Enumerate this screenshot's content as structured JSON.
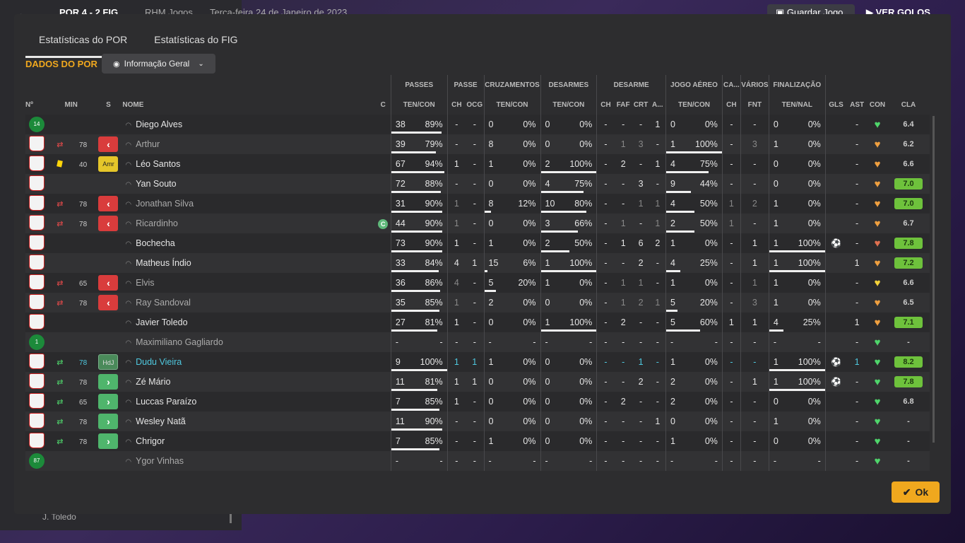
{
  "topbar": {
    "back_icon": "arrow-left-icon",
    "score": "POR   4 - 2   FIG",
    "stadium": "RHM Jogos",
    "date": "Terça-feira 24 de Janeiro de 2023",
    "save_label": "Guardar Jogo",
    "goals_label": "VER GOLOS"
  },
  "bottom": {
    "name": "J. Toledo"
  },
  "tabs": [
    "Estatísticas do POR",
    "Estatísticas do FIG"
  ],
  "section_title": "DADOS DO POR",
  "dropdown": {
    "label": "Informação Geral"
  },
  "ok_label": "Ok",
  "groups": {
    "passes": "PASSES",
    "passe": "PASSE",
    "cruz": "CRUZAMENTOS",
    "desarmes": "DESARMES",
    "desarme": "DESARME",
    "aereo": "JOGO AÉREO",
    "ca": "CA...",
    "varios": "VÁRIOS",
    "final": "FINALIZAÇÃO"
  },
  "headers": {
    "no": "Nº",
    "min": "MIN",
    "s": "S",
    "nome": "NOME",
    "c": "C",
    "tencon": "TEN/CON",
    "ch": "CH",
    "ocg": "OCG",
    "faf": "FAF",
    "crt": "CRT",
    "a": "A...",
    "fnt": "FNT",
    "tennal": "TEN/NAL",
    "gls": "GLS",
    "ast": "AST",
    "con": "CON",
    "cla": "CLA"
  },
  "colors": {
    "accent": "#f0a81e",
    "sub_out": "#d93c3c",
    "sub_in": "#4fb56c",
    "rating_green": "#6ec23c",
    "highlight": "#4fc9e0"
  },
  "players": [
    {
      "num": "14",
      "gk": true,
      "sub": "",
      "min": "",
      "s": "",
      "name": "Diego Alves",
      "style": "",
      "cap": false,
      "passes": [
        "38",
        "89%",
        0.89
      ],
      "p_ch": "-",
      "p_ocg": "-",
      "cr": [
        "0",
        "0%",
        0
      ],
      "des": [
        "0",
        "0%",
        0
      ],
      "d_ch": "-",
      "d_faf": "-",
      "d_crt": "-",
      "d_a": "1",
      "aer": [
        "0",
        "0%",
        0
      ],
      "ca": "-",
      "fnt": "-",
      "fin": [
        "0",
        "0%",
        0
      ],
      "gls": "",
      "ast": "-",
      "con": "green",
      "cla": "6.4",
      "cla_g": false
    },
    {
      "num": "",
      "gk": false,
      "sub": "out",
      "min": "78",
      "s": "out",
      "name": "Arthur",
      "style": "dim",
      "cap": false,
      "passes": [
        "39",
        "79%",
        0.79
      ],
      "p_ch": "-",
      "p_ocg": "-",
      "cr": [
        "8",
        "0%",
        0
      ],
      "des": [
        "0",
        "0%",
        0
      ],
      "d_ch": "-",
      "d_faf": "1",
      "d_crt": "3",
      "d_a": "-",
      "aer": [
        "1",
        "100%",
        1
      ],
      "ca": "-",
      "fnt": "3",
      "fin": [
        "1",
        "0%",
        0
      ],
      "gls": "",
      "ast": "-",
      "con": "orange",
      "cla": "6.2",
      "cla_g": false
    },
    {
      "num": "",
      "gk": false,
      "sub": "yellow",
      "min": "40",
      "s": "amr",
      "name": "Léo Santos",
      "style": "",
      "cap": false,
      "passes": [
        "67",
        "94%",
        0.94
      ],
      "p_ch": "1",
      "p_ocg": "-",
      "cr": [
        "1",
        "0%",
        0
      ],
      "des": [
        "2",
        "100%",
        1
      ],
      "d_ch": "-",
      "d_faf": "2",
      "d_crt": "-",
      "d_a": "1",
      "aer": [
        "4",
        "75%",
        0.75
      ],
      "ca": "-",
      "fnt": "-",
      "fin": [
        "0",
        "0%",
        0
      ],
      "gls": "",
      "ast": "-",
      "con": "orange",
      "cla": "6.6",
      "cla_g": false
    },
    {
      "num": "",
      "gk": false,
      "sub": "",
      "min": "",
      "s": "",
      "name": "Yan Souto",
      "style": "",
      "cap": false,
      "passes": [
        "72",
        "88%",
        0.88
      ],
      "p_ch": "-",
      "p_ocg": "-",
      "cr": [
        "0",
        "0%",
        0
      ],
      "des": [
        "4",
        "75%",
        0.75
      ],
      "d_ch": "-",
      "d_faf": "-",
      "d_crt": "3",
      "d_a": "-",
      "aer": [
        "9",
        "44%",
        0.44
      ],
      "ca": "-",
      "fnt": "-",
      "fin": [
        "0",
        "0%",
        0
      ],
      "gls": "",
      "ast": "-",
      "con": "orange",
      "cla": "7.0",
      "cla_g": true
    },
    {
      "num": "",
      "gk": false,
      "sub": "out",
      "min": "78",
      "s": "out",
      "name": "Jonathan Silva",
      "style": "dim",
      "cap": false,
      "passes": [
        "31",
        "90%",
        0.9
      ],
      "p_ch": "1",
      "p_ocg": "-",
      "cr": [
        "8",
        "12%",
        0.12
      ],
      "des": [
        "10",
        "80%",
        0.8
      ],
      "d_ch": "-",
      "d_faf": "-",
      "d_crt": "1",
      "d_a": "1",
      "aer": [
        "4",
        "50%",
        0.5
      ],
      "ca": "1",
      "fnt": "2",
      "fin": [
        "1",
        "0%",
        0
      ],
      "gls": "",
      "ast": "-",
      "con": "orange",
      "cla": "7.0",
      "cla_g": true
    },
    {
      "num": "",
      "gk": false,
      "sub": "out",
      "min": "78",
      "s": "out",
      "name": "Ricardinho",
      "style": "dim",
      "cap": true,
      "passes": [
        "44",
        "90%",
        0.9
      ],
      "p_ch": "1",
      "p_ocg": "-",
      "cr": [
        "0",
        "0%",
        0
      ],
      "des": [
        "3",
        "66%",
        0.66
      ],
      "d_ch": "-",
      "d_faf": "1",
      "d_crt": "-",
      "d_a": "1",
      "aer": [
        "2",
        "50%",
        0.5
      ],
      "ca": "1",
      "fnt": "-",
      "fin": [
        "1",
        "0%",
        0
      ],
      "gls": "",
      "ast": "-",
      "con": "orange",
      "cla": "6.7",
      "cla_g": false
    },
    {
      "num": "",
      "gk": false,
      "sub": "",
      "min": "",
      "s": "",
      "name": "Bochecha",
      "style": "",
      "cap": false,
      "passes": [
        "73",
        "90%",
        0.9
      ],
      "p_ch": "1",
      "p_ocg": "-",
      "cr": [
        "1",
        "0%",
        0
      ],
      "des": [
        "2",
        "50%",
        0.5
      ],
      "d_ch": "-",
      "d_faf": "1",
      "d_crt": "6",
      "d_a": "2",
      "aer": [
        "1",
        "0%",
        0
      ],
      "ca": "-",
      "fnt": "1",
      "fin": [
        "1",
        "100%",
        1
      ],
      "gls": "ball",
      "ast": "-",
      "con": "red",
      "cla": "7.8",
      "cla_g": true
    },
    {
      "num": "",
      "gk": false,
      "sub": "",
      "min": "",
      "s": "",
      "name": "Matheus Índio",
      "style": "",
      "cap": false,
      "passes": [
        "33",
        "84%",
        0.84
      ],
      "p_ch": "4",
      "p_ocg": "1",
      "cr": [
        "15",
        "6%",
        0.06
      ],
      "des": [
        "1",
        "100%",
        1
      ],
      "d_ch": "-",
      "d_faf": "-",
      "d_crt": "2",
      "d_a": "-",
      "aer": [
        "4",
        "25%",
        0.25
      ],
      "ca": "-",
      "fnt": "1",
      "fin": [
        "1",
        "100%",
        1
      ],
      "gls": "",
      "ast": "1",
      "con": "orange",
      "cla": "7.2",
      "cla_g": true
    },
    {
      "num": "",
      "gk": false,
      "sub": "out",
      "min": "65",
      "s": "out",
      "name": "Elvis",
      "style": "dim",
      "cap": false,
      "passes": [
        "36",
        "86%",
        0.86
      ],
      "p_ch": "4",
      "p_ocg": "-",
      "cr": [
        "5",
        "20%",
        0.2
      ],
      "des": [
        "1",
        "0%",
        0
      ],
      "d_ch": "-",
      "d_faf": "1",
      "d_crt": "1",
      "d_a": "-",
      "aer": [
        "1",
        "0%",
        0
      ],
      "ca": "-",
      "fnt": "1",
      "fin": [
        "1",
        "0%",
        0
      ],
      "gls": "",
      "ast": "-",
      "con": "yellow",
      "cla": "6.6",
      "cla_g": false
    },
    {
      "num": "",
      "gk": false,
      "sub": "out",
      "min": "78",
      "s": "out",
      "name": "Ray Sandoval",
      "style": "dim",
      "cap": false,
      "passes": [
        "35",
        "85%",
        0.85
      ],
      "p_ch": "1",
      "p_ocg": "-",
      "cr": [
        "2",
        "0%",
        0
      ],
      "des": [
        "0",
        "0%",
        0
      ],
      "d_ch": "-",
      "d_faf": "1",
      "d_crt": "2",
      "d_a": "1",
      "aer": [
        "5",
        "20%",
        0.2
      ],
      "ca": "-",
      "fnt": "3",
      "fin": [
        "1",
        "0%",
        0
      ],
      "gls": "",
      "ast": "-",
      "con": "orange",
      "cla": "6.5",
      "cla_g": false
    },
    {
      "num": "",
      "gk": false,
      "sub": "",
      "min": "",
      "s": "",
      "name": "Javier Toledo",
      "style": "",
      "cap": false,
      "passes": [
        "27",
        "81%",
        0.81
      ],
      "p_ch": "1",
      "p_ocg": "-",
      "cr": [
        "0",
        "0%",
        0
      ],
      "des": [
        "1",
        "100%",
        1
      ],
      "d_ch": "-",
      "d_faf": "2",
      "d_crt": "-",
      "d_a": "-",
      "aer": [
        "5",
        "60%",
        0.6
      ],
      "ca": "1",
      "fnt": "1",
      "fin": [
        "4",
        "25%",
        0.25
      ],
      "gls": "",
      "ast": "1",
      "con": "orange",
      "cla": "7.1",
      "cla_g": true
    },
    {
      "num": "1",
      "gk": true,
      "sub": "",
      "min": "",
      "s": "",
      "name": "Maximiliano Gagliardo",
      "style": "dim",
      "cap": false,
      "passes": [
        "-",
        "-",
        0
      ],
      "p_ch": "-",
      "p_ocg": "-",
      "cr": [
        "-",
        "-",
        0
      ],
      "des": [
        "-",
        "-",
        0
      ],
      "d_ch": "-",
      "d_faf": "-",
      "d_crt": "-",
      "d_a": "-",
      "aer": [
        "-",
        "-",
        0
      ],
      "ca": "-",
      "fnt": "-",
      "fin": [
        "-",
        "-",
        0
      ],
      "gls": "",
      "ast": "-",
      "con": "green",
      "cla": "-",
      "cla_g": false
    },
    {
      "num": "",
      "gk": false,
      "sub": "in",
      "min": "78",
      "s": "hdl",
      "name": "Dudu Vieira",
      "style": "hl",
      "cap": false,
      "passes": [
        "9",
        "100%",
        1
      ],
      "p_ch": "1",
      "p_ocg": "1",
      "cr": [
        "1",
        "0%",
        0
      ],
      "des": [
        "0",
        "0%",
        0
      ],
      "d_ch": "-",
      "d_faf": "-",
      "d_crt": "1",
      "d_a": "-",
      "aer": [
        "1",
        "0%",
        0
      ],
      "ca": "-",
      "fnt": "-",
      "fin": [
        "1",
        "100%",
        1
      ],
      "gls": "ball",
      "ast": "1",
      "con": "green",
      "cla": "8.2",
      "cla_g": true
    },
    {
      "num": "",
      "gk": false,
      "sub": "in",
      "min": "78",
      "s": "in",
      "name": "Zé Mário",
      "style": "",
      "cap": false,
      "passes": [
        "11",
        "81%",
        0.81
      ],
      "p_ch": "1",
      "p_ocg": "1",
      "cr": [
        "0",
        "0%",
        0
      ],
      "des": [
        "0",
        "0%",
        0
      ],
      "d_ch": "-",
      "d_faf": "-",
      "d_crt": "2",
      "d_a": "-",
      "aer": [
        "2",
        "0%",
        0
      ],
      "ca": "-",
      "fnt": "1",
      "fin": [
        "1",
        "100%",
        1
      ],
      "gls": "ball",
      "ast": "-",
      "con": "green",
      "cla": "7.8",
      "cla_g": true
    },
    {
      "num": "",
      "gk": false,
      "sub": "in",
      "min": "65",
      "s": "in",
      "name": "Luccas Paraízo",
      "style": "",
      "cap": false,
      "passes": [
        "7",
        "85%",
        0.85
      ],
      "p_ch": "1",
      "p_ocg": "-",
      "cr": [
        "0",
        "0%",
        0
      ],
      "des": [
        "0",
        "0%",
        0
      ],
      "d_ch": "-",
      "d_faf": "2",
      "d_crt": "-",
      "d_a": "-",
      "aer": [
        "2",
        "0%",
        0
      ],
      "ca": "-",
      "fnt": "-",
      "fin": [
        "0",
        "0%",
        0
      ],
      "gls": "",
      "ast": "-",
      "con": "green",
      "cla": "6.8",
      "cla_g": false
    },
    {
      "num": "",
      "gk": false,
      "sub": "in",
      "min": "78",
      "s": "in",
      "name": "Wesley Natã",
      "style": "",
      "cap": false,
      "passes": [
        "11",
        "90%",
        0.9
      ],
      "p_ch": "-",
      "p_ocg": "-",
      "cr": [
        "0",
        "0%",
        0
      ],
      "des": [
        "0",
        "0%",
        0
      ],
      "d_ch": "-",
      "d_faf": "-",
      "d_crt": "-",
      "d_a": "1",
      "aer": [
        "0",
        "0%",
        0
      ],
      "ca": "-",
      "fnt": "-",
      "fin": [
        "1",
        "0%",
        0
      ],
      "gls": "",
      "ast": "-",
      "con": "green",
      "cla": "-",
      "cla_g": false
    },
    {
      "num": "",
      "gk": false,
      "sub": "in",
      "min": "78",
      "s": "in",
      "name": "Chrigor",
      "style": "",
      "cap": false,
      "passes": [
        "7",
        "85%",
        0.85
      ],
      "p_ch": "-",
      "p_ocg": "-",
      "cr": [
        "1",
        "0%",
        0
      ],
      "des": [
        "0",
        "0%",
        0
      ],
      "d_ch": "-",
      "d_faf": "-",
      "d_crt": "-",
      "d_a": "-",
      "aer": [
        "1",
        "0%",
        0
      ],
      "ca": "-",
      "fnt": "-",
      "fin": [
        "0",
        "0%",
        0
      ],
      "gls": "",
      "ast": "-",
      "con": "green",
      "cla": "-",
      "cla_g": false
    },
    {
      "num": "87",
      "gk": true,
      "sub": "",
      "min": "",
      "s": "",
      "name": "Ygor Vinhas",
      "style": "dim",
      "cap": false,
      "passes": [
        "-",
        "-",
        0
      ],
      "p_ch": "-",
      "p_ocg": "-",
      "cr": [
        "-",
        "-",
        0
      ],
      "des": [
        "-",
        "-",
        0
      ],
      "d_ch": "-",
      "d_faf": "-",
      "d_crt": "-",
      "d_a": "-",
      "aer": [
        "-",
        "-",
        0
      ],
      "ca": "-",
      "fnt": "-",
      "fin": [
        "-",
        "-",
        0
      ],
      "gls": "",
      "ast": "-",
      "con": "green",
      "cla": "-",
      "cla_g": false
    }
  ]
}
